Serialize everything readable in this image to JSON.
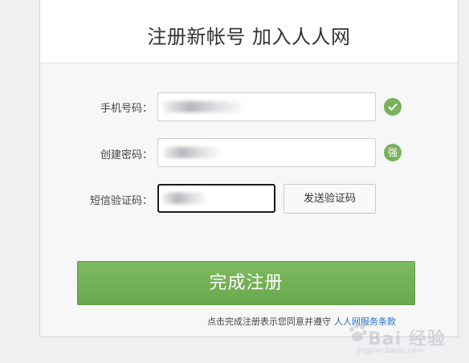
{
  "header": {
    "title": "注册新帐号 加入人人网"
  },
  "form": {
    "phone_label": "手机号码：",
    "password_label": "创建密码：",
    "sms_label": "短信验证码：",
    "password_strength": "强",
    "sms_button_label": "发送验证码",
    "submit_label": "完成注册"
  },
  "footer": {
    "agree_text": "点击完成注册表示您同意并遵守",
    "terms_link": "人人网服务条款"
  },
  "watermark": {
    "text": "Bai 经验",
    "sub": "jingyan.baidu.com"
  },
  "colors": {
    "accent_green": "#6aa74d",
    "link_blue": "#2b6fc2"
  }
}
